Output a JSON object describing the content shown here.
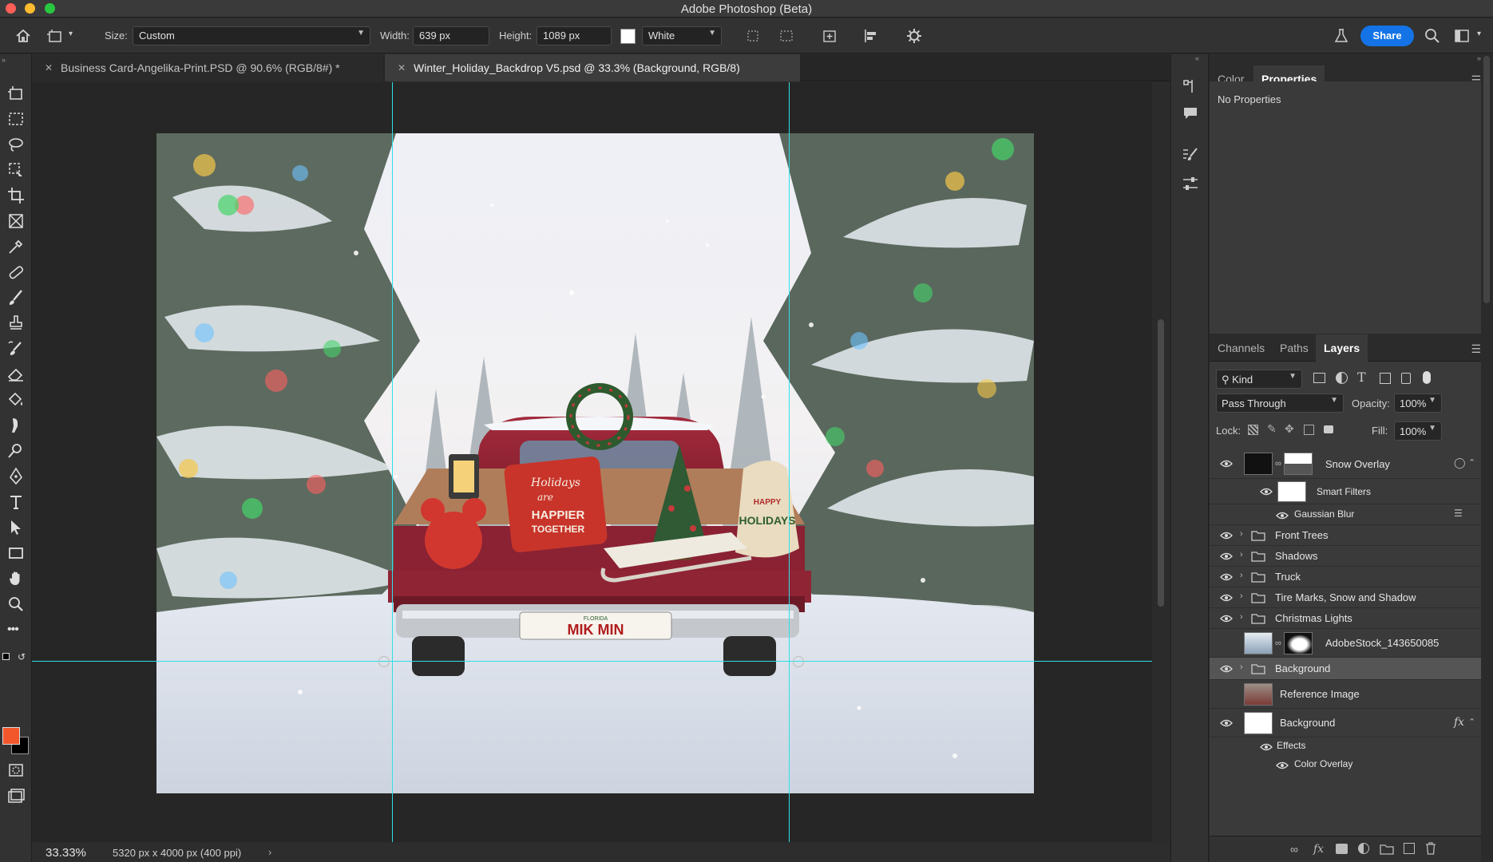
{
  "app": {
    "title": "Adobe Photoshop (Beta)"
  },
  "options_bar": {
    "size_label": "Size:",
    "size_value": "Custom",
    "width_label": "Width:",
    "width_value": "639 px",
    "height_label": "Height:",
    "height_value": "1089 px",
    "fill_value": "White",
    "share_label": "Share"
  },
  "tabs": [
    {
      "label": "Business Card-Angelika-Print.PSD @ 90.6% (RGB/8#) *",
      "active": false
    },
    {
      "label": "Winter_Holiday_Backdrop V5.psd @ 33.3% (Background, RGB/8)",
      "active": true
    }
  ],
  "status": {
    "zoom": "33.33%",
    "doc_info": "5320 px x 4000 px (400 ppi)",
    "chevron": "›"
  },
  "canvas": {
    "plate_state": "FLORIDA",
    "plate_text": "MIK MIN",
    "pillow_text_1": "Holidays",
    "pillow_text_2": "are",
    "pillow_text_3": "HAPPIER",
    "pillow_text_4": "TOGETHER",
    "sack_text_1": "HAPPY",
    "sack_text_2": "HOLIDAYS"
  },
  "top_panel": {
    "tabs": [
      "Color",
      "Properties"
    ],
    "active_tab": "Properties",
    "body_text": "No Properties"
  },
  "layers_panel": {
    "tabs": [
      "Channels",
      "Paths",
      "Layers"
    ],
    "active_tab": "Layers",
    "filter_kind": "Kind",
    "blend_mode": "Pass Through",
    "opacity_label": "Opacity:",
    "opacity_value": "100%",
    "lock_label": "Lock:",
    "fill_label": "Fill:",
    "fill_value": "100%",
    "layers": [
      {
        "name": "Snow Overlay",
        "visible": true
      },
      {
        "name": "Smart Filters",
        "visible": true
      },
      {
        "name": "Gaussian Blur",
        "visible": true
      },
      {
        "name": "Front Trees",
        "visible": true
      },
      {
        "name": "Shadows",
        "visible": true
      },
      {
        "name": "Truck",
        "visible": true
      },
      {
        "name": "Tire Marks, Snow and Shadow",
        "visible": true
      },
      {
        "name": "Christmas Lights",
        "visible": true
      },
      {
        "name": "AdobeStock_143650085",
        "visible": false
      },
      {
        "name": "Background",
        "visible": true,
        "selected": true
      },
      {
        "name": "Reference Image",
        "visible": false
      },
      {
        "name": "Background",
        "visible": true
      },
      {
        "name": "Effects",
        "visible": true
      },
      {
        "name": "Color Overlay",
        "visible": true
      }
    ],
    "fx_label": "fx"
  },
  "colors": {
    "accent": "#1473e6",
    "guide": "#2fe0e8",
    "foreground_swatch": "#f2562b",
    "background_swatch": "#000000"
  }
}
